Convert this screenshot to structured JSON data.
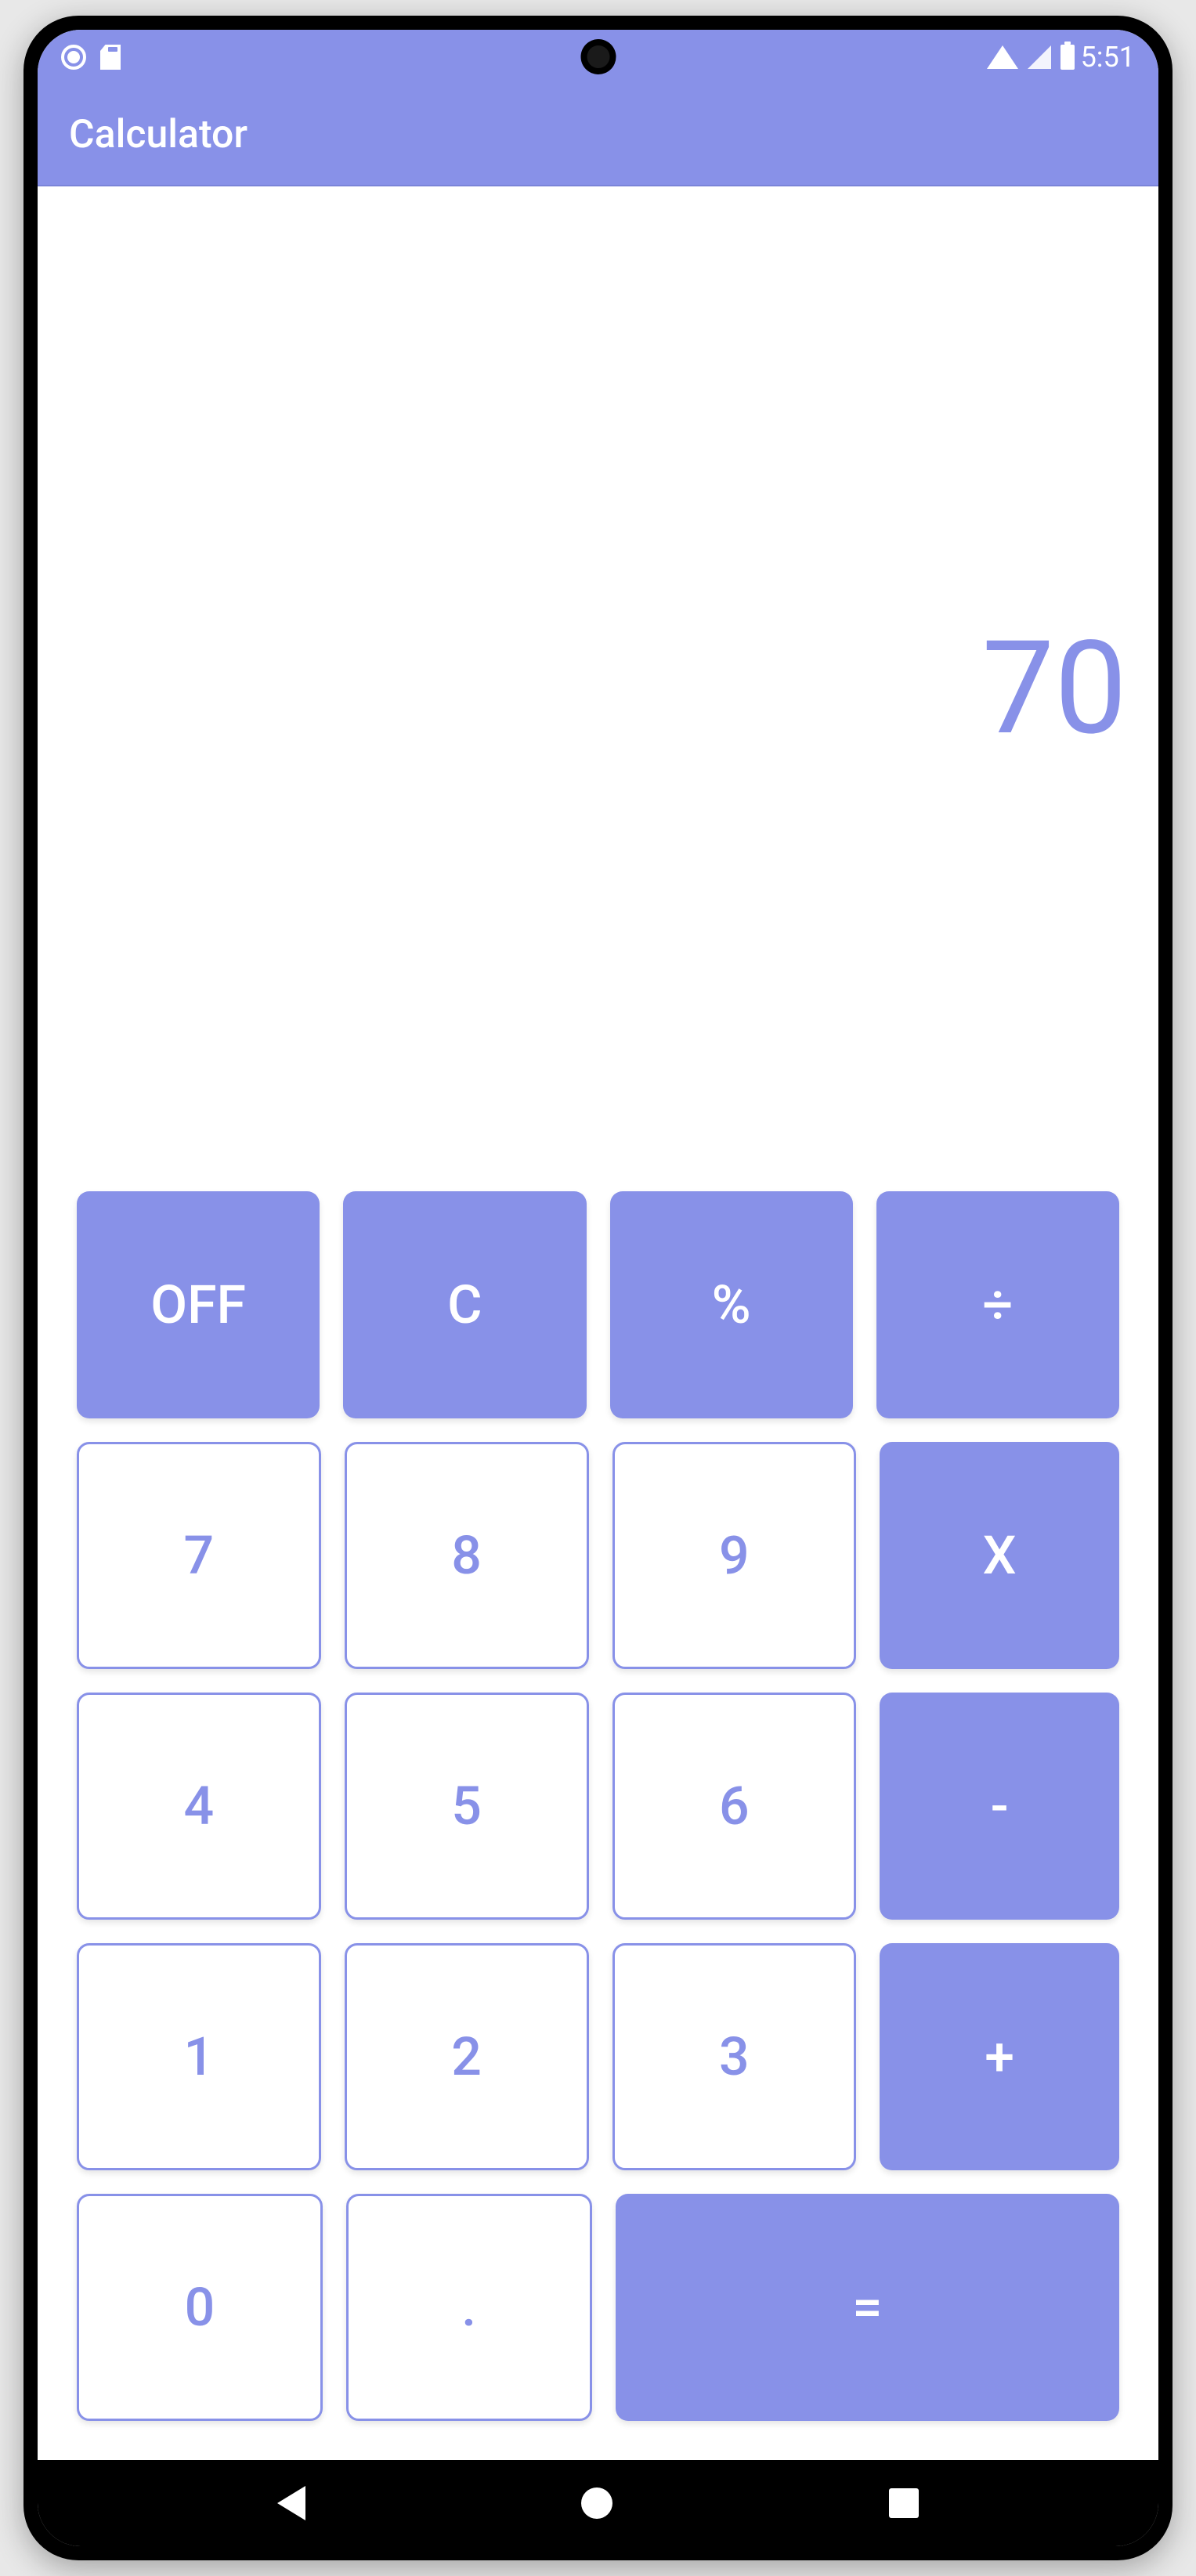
{
  "status_bar": {
    "time": "5:51"
  },
  "app": {
    "title": "Calculator"
  },
  "display": {
    "value": "70"
  },
  "keys": {
    "off": "OFF",
    "clear": "C",
    "percent": "%",
    "divide": "÷",
    "seven": "7",
    "eight": "8",
    "nine": "9",
    "multiply": "X",
    "four": "4",
    "five": "5",
    "six": "6",
    "subtract": "-",
    "one": "1",
    "two": "2",
    "three": "3",
    "add": "+",
    "zero": "0",
    "decimal": ".",
    "equals": "="
  },
  "colors": {
    "accent": "#8891e8"
  }
}
